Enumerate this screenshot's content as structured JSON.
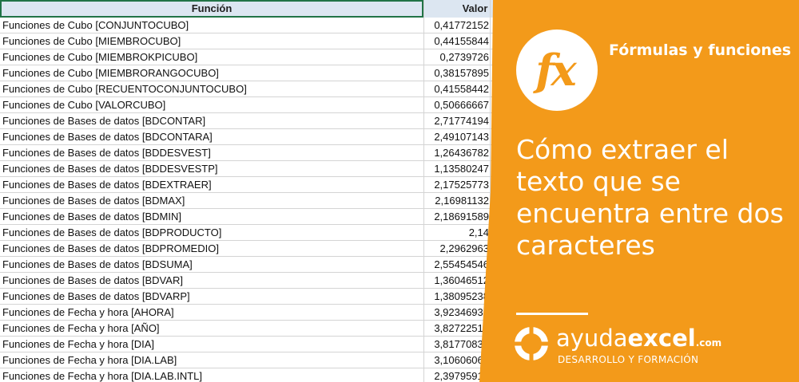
{
  "sheet": {
    "headers": {
      "funcion": "Función",
      "valor": "Valor"
    },
    "rows": [
      {
        "name": "Funciones de Cubo [CONJUNTOCUBO]",
        "value": "0,41772152"
      },
      {
        "name": "Funciones de Cubo [MIEMBROCUBO]",
        "value": "0,44155844"
      },
      {
        "name": "Funciones de Cubo [MIEMBROKPICUBO]",
        "value": "0,2739726"
      },
      {
        "name": "Funciones de Cubo [MIEMBRORANGOCUBO]",
        "value": "0,38157895"
      },
      {
        "name": "Funciones de Cubo [RECUENTOCONJUNTOCUBO]",
        "value": "0,41558442"
      },
      {
        "name": "Funciones de Cubo [VALORCUBO]",
        "value": "0,50666667"
      },
      {
        "name": "Funciones de Bases de datos [BDCONTAR]",
        "value": "2,71774194"
      },
      {
        "name": "Funciones de Bases de datos [BDCONTARA]",
        "value": "2,49107143"
      },
      {
        "name": "Funciones de Bases de datos [BDDESVEST]",
        "value": "1,26436782"
      },
      {
        "name": "Funciones de Bases de datos [BDDESVESTP]",
        "value": "1,13580247"
      },
      {
        "name": "Funciones de Bases de datos [BDEXTRAER]",
        "value": "2,17525773"
      },
      {
        "name": "Funciones de Bases de datos [BDMAX]",
        "value": "2,16981132"
      },
      {
        "name": "Funciones de Bases de datos [BDMIN]",
        "value": "2,18691589"
      },
      {
        "name": "Funciones de Bases de datos [BDPRODUCTO]",
        "value": "2,14"
      },
      {
        "name": "Funciones de Bases de datos [BDPROMEDIO]",
        "value": "2,2962963"
      },
      {
        "name": "Funciones de Bases de datos [BDSUMA]",
        "value": "2,55454546"
      },
      {
        "name": "Funciones de Bases de datos [BDVAR]",
        "value": "1,36046512"
      },
      {
        "name": "Funciones de Bases de datos [BDVARP]",
        "value": "1,38095238"
      },
      {
        "name": "Funciones de Fecha y hora [AHORA]",
        "value": "3,92346939"
      },
      {
        "name": "Funciones de Fecha y hora [AÑO]",
        "value": "3,82722513"
      },
      {
        "name": "Funciones de Fecha y hora [DIA]",
        "value": "3,81770833"
      },
      {
        "name": "Funciones de Fecha y hora [DIA.LAB]",
        "value": "3,10606061"
      },
      {
        "name": "Funciones de Fecha y hora [DIA.LAB.INTL]",
        "value": "2,39795918"
      }
    ]
  },
  "panel": {
    "fx_symbol": "fx",
    "subtitle": "Fórmulas y funciones",
    "title": "Cómo extraer el texto que se encuentra entre dos caracteres",
    "brand_part1": "ayuda",
    "brand_part2": "excel",
    "brand_part3": ".com",
    "tagline": "DESARROLLO Y FORMACIÓN",
    "colors": {
      "orange": "#f39a1a",
      "white": "#ffffff"
    },
    "logo_icon": "lifebuoy-icon"
  }
}
